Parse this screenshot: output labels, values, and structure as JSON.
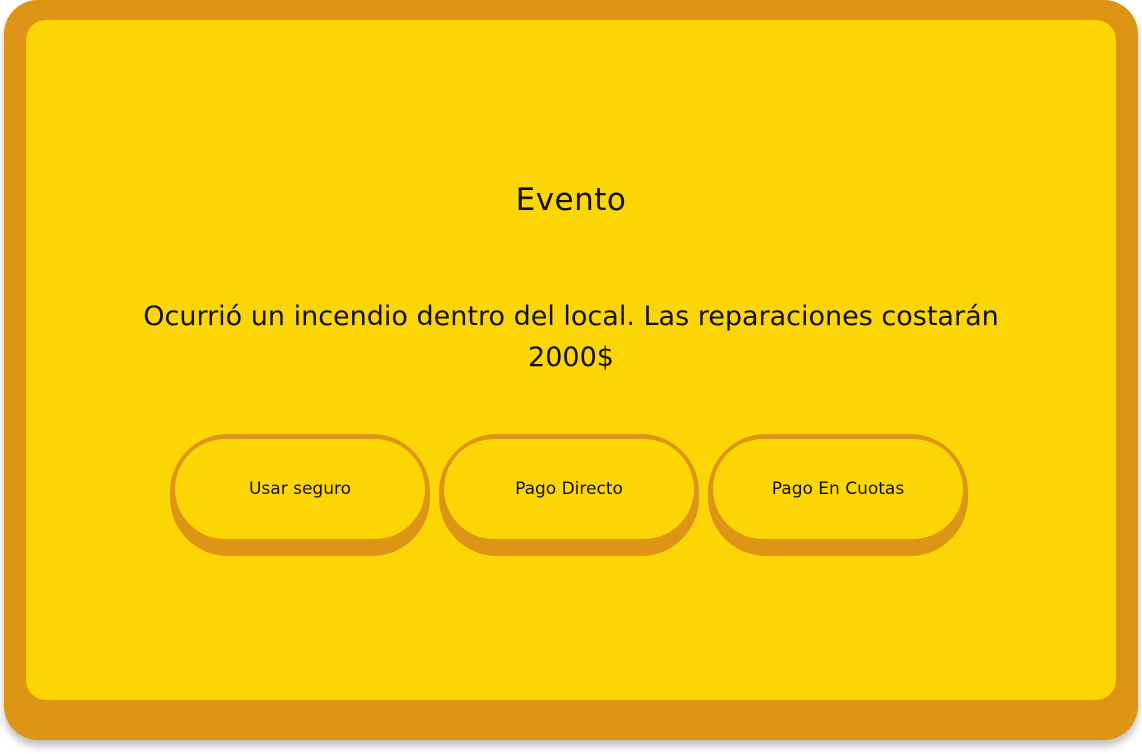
{
  "event": {
    "title": "Evento",
    "message": "Ocurrió un incendio dentro del local. Las reparaciones costarán 2000$"
  },
  "options": [
    {
      "label": "Usar seguro"
    },
    {
      "label": "Pago Directo"
    },
    {
      "label": "Pago En Cuotas"
    }
  ],
  "colors": {
    "frame": "#de9414",
    "panel": "#fcd504",
    "text": "#111111"
  }
}
